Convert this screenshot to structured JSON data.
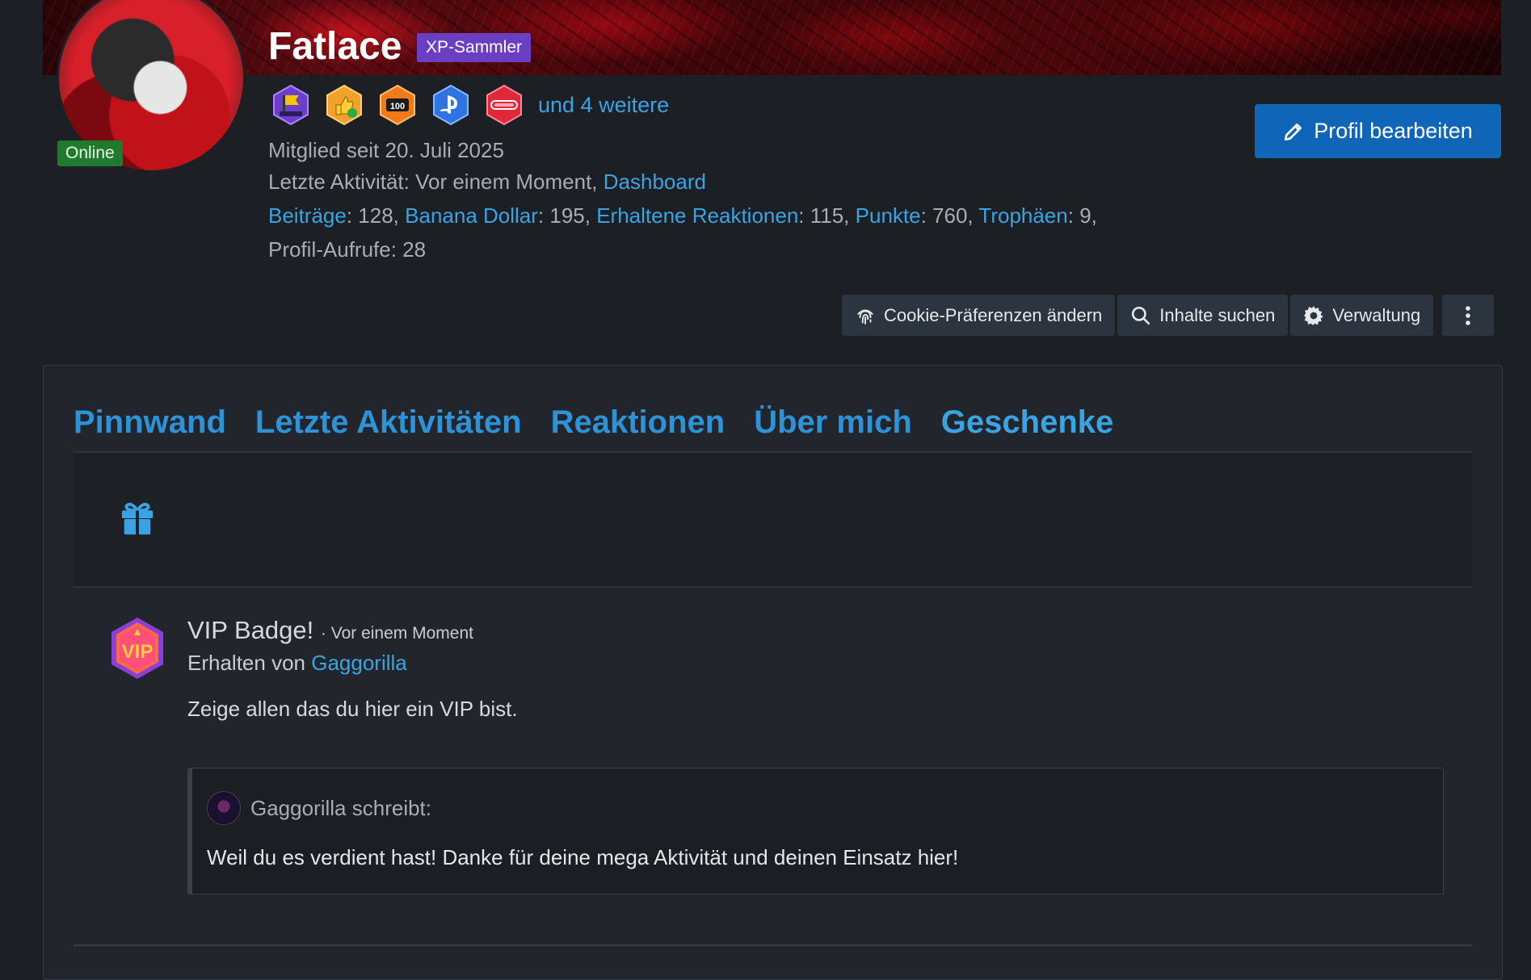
{
  "profile": {
    "username": "Fatlace",
    "rank": "XP-Sammler",
    "status": "Online",
    "more_trophies": "und 4 weitere",
    "member_since": "Mitglied seit 20. Juli 2025",
    "last_activity_label": "Letzte Aktivität: Vor einem Moment,",
    "last_activity_link": "Dashboard",
    "stats": {
      "posts_label": "Beiträge",
      "posts_value": ": 128,",
      "banana_label": "Banana Dollar",
      "banana_value": ": 195,",
      "reactions_label": "Erhaltene Reaktionen",
      "reactions_value": ": 115,",
      "points_label": "Punkte",
      "points_value": ": 760,",
      "trophies_label": "Trophäen",
      "trophies_value": ": 9,"
    },
    "profile_views": "Profil-Aufrufe: 28",
    "edit_button": "Profil bearbeiten"
  },
  "actions": {
    "cookie": "Cookie-Präferenzen ändern",
    "search": "Inhalte suchen",
    "admin": "Verwaltung"
  },
  "tabs": [
    {
      "label": "Pinnwand"
    },
    {
      "label": "Letzte Aktivitäten"
    },
    {
      "label": "Reaktionen"
    },
    {
      "label": "Über mich"
    },
    {
      "label": "Geschenke"
    }
  ],
  "gift_entry": {
    "title": "VIP Badge!",
    "time": "· Vor einem Moment",
    "from_label": "Erhalten von",
    "from_user": "Gaggorilla",
    "description": "Zeige allen das du hier ein VIP bist.",
    "quote_author": "Gaggorilla schreibt:",
    "quote_text": "Weil du es verdient hast! Danke für deine mega Aktivität und deinen Einsatz hier!"
  },
  "colors": {
    "accent": "#3aa3e3",
    "rank_badge": "#6a3fc4",
    "online_badge": "#1f7a2f",
    "edit_button": "#0f66b8"
  }
}
